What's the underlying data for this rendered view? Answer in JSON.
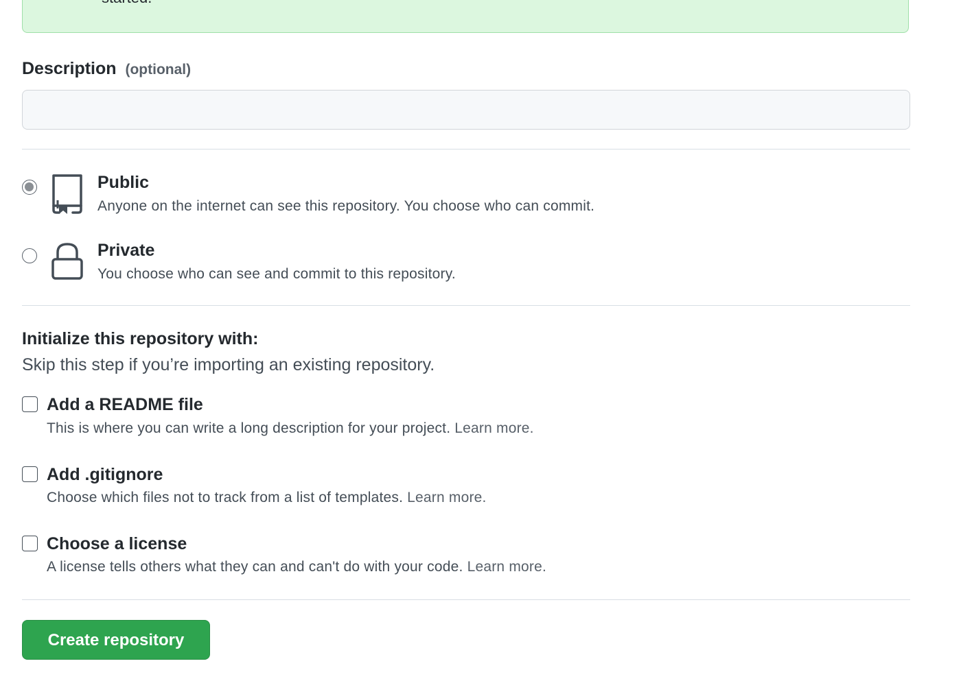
{
  "top_notice": {
    "text_fragment": "started."
  },
  "description": {
    "label": "Description",
    "optional_label": "(optional)",
    "value": "",
    "placeholder": ""
  },
  "visibility": {
    "options": [
      {
        "title": "Public",
        "description": "Anyone on the internet can see this repository. You choose who can commit.",
        "icon": "repo-book-icon",
        "selected": true
      },
      {
        "title": "Private",
        "description": "You choose who can see and commit to this repository.",
        "icon": "lock-icon",
        "selected": false
      }
    ]
  },
  "initialize": {
    "title": "Initialize this repository with:",
    "subtitle": "Skip this step if you’re importing an existing repository.",
    "options": [
      {
        "title": "Add a README file",
        "description": "This is where you can write a long description for your project.",
        "learn_more": "Learn more.",
        "checked": false
      },
      {
        "title": "Add .gitignore",
        "description": "Choose which files not to track from a list of templates.",
        "learn_more": "Learn more.",
        "checked": false
      },
      {
        "title": "Choose a license",
        "description": "A license tells others what they can and can't do with your code.",
        "learn_more": "Learn more.",
        "checked": false
      }
    ]
  },
  "actions": {
    "create_label": "Create repository"
  },
  "colors": {
    "primary_button": "#2ea44f",
    "notice_background": "#dcf7df",
    "text": "#24292e",
    "muted_text": "#444d56"
  }
}
